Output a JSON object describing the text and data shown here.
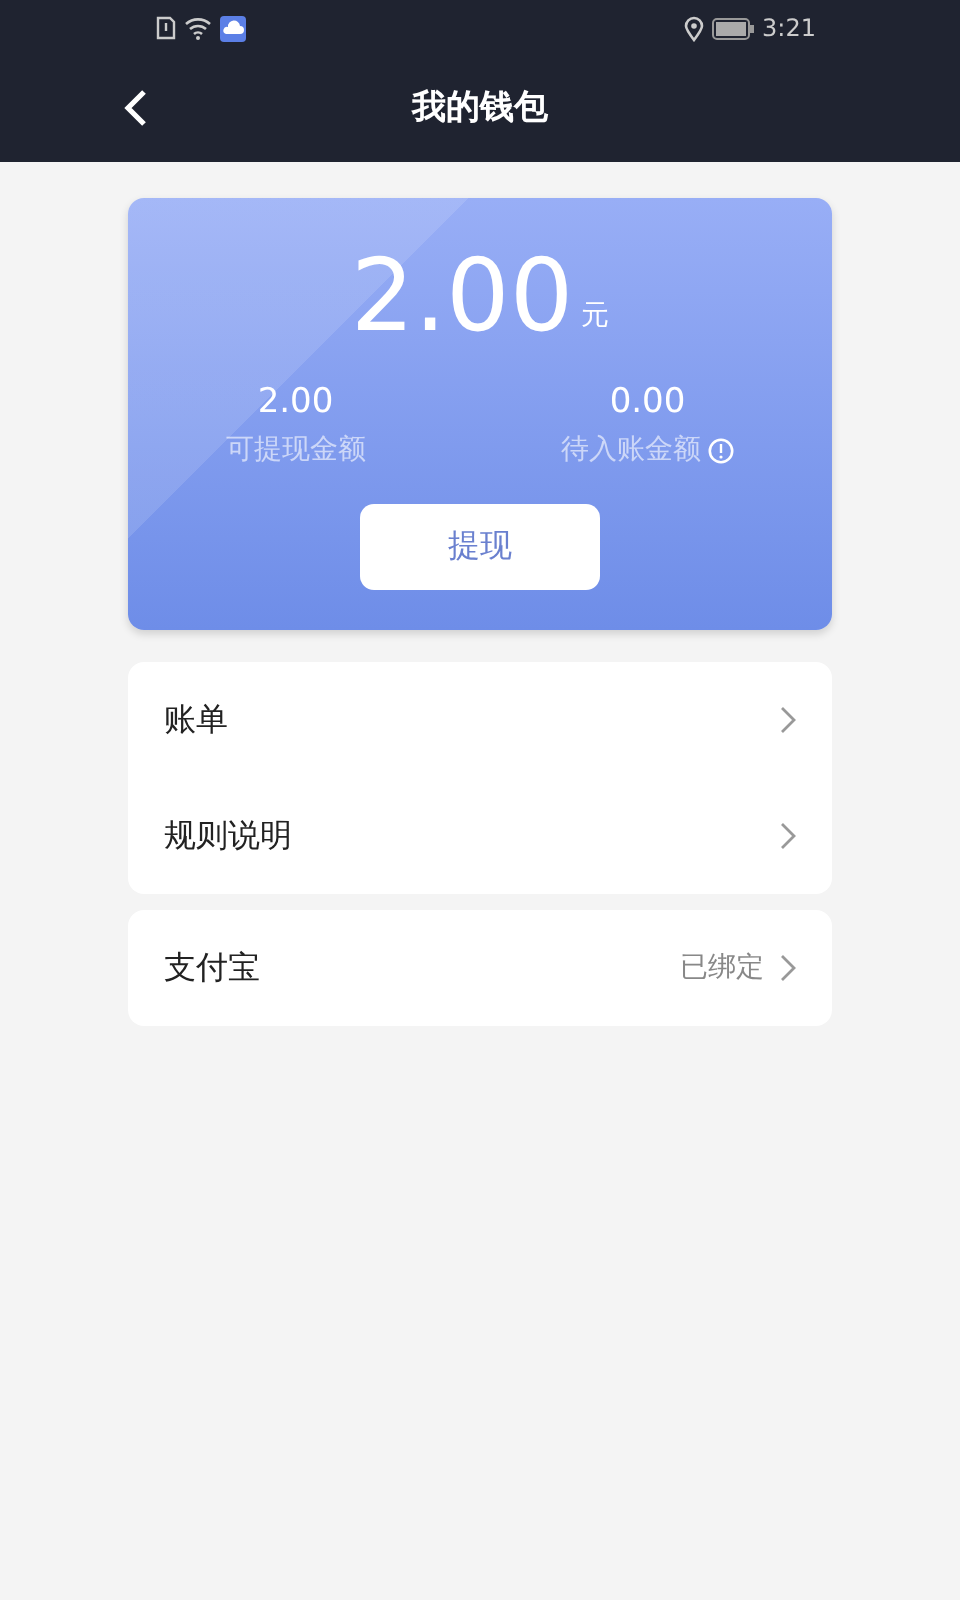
{
  "status_bar": {
    "time": "3:21"
  },
  "header": {
    "title": "我的钱包"
  },
  "wallet": {
    "total": "2.00",
    "unit": "元",
    "stats": [
      {
        "value": "2.00",
        "label": "可提现金额",
        "info": false
      },
      {
        "value": "0.00",
        "label": "待入账金额",
        "info": true
      }
    ],
    "button": "提现"
  },
  "groups": [
    [
      {
        "label": "账单"
      },
      {
        "label": "规则说明"
      }
    ],
    [
      {
        "label": "支付宝",
        "value": "已绑定"
      }
    ]
  ]
}
